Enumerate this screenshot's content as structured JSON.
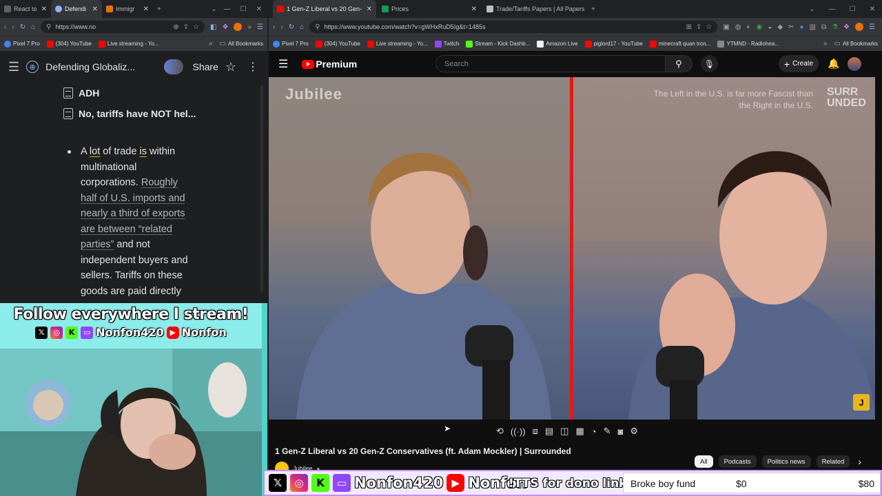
{
  "left_browser": {
    "tabs": [
      {
        "label": "React to",
        "favicon": "#5f6368"
      },
      {
        "label": "Defendi",
        "favicon": "#8ab4f8"
      },
      {
        "label": "Immigr",
        "favicon": "#e37400"
      }
    ],
    "url": "https://www.no",
    "bookmarks": [
      {
        "label": "Pixel 7 Pro",
        "color": "#4285f4"
      },
      {
        "label": "(304) YouTube",
        "color": "#ff0000"
      },
      {
        "label": "Live streaming - Yo...",
        "color": "#ff0000"
      }
    ],
    "all_bookmarks": "All Bookmarks"
  },
  "notebook": {
    "title": "Defending Globaliz...",
    "share": "Share",
    "sources": [
      "ADH",
      "No, tariffs have NOT hel..."
    ],
    "bullet": {
      "part1": "A ",
      "hl1": "lot",
      "part2": " of trade ",
      "hl2": "is",
      "part3": " within multinational corporations. ",
      "cite": "Roughly half of U.S. imports and nearly a third of exports are between “related parties”",
      "part4": " and not independent buyers and sellers. Tariffs on these goods are paid directly"
    }
  },
  "overlay": {
    "title": "Follow everywhere I stream!",
    "handle1": "Nonfon420",
    "handle2": "Nonfon"
  },
  "right_browser": {
    "tabs": [
      {
        "label": "1 Gen-Z Liberal vs 20 Gen-",
        "favicon": "#ff0000"
      },
      {
        "label": "Prices",
        "favicon": "#0f9d58"
      },
      {
        "label": "Trade/Tariffs Papers | All Papers",
        "favicon": "#bdbdbd"
      }
    ],
    "url": "https://www.youtube.com/watch?v=gWHxRuD5Ig&t=1485s",
    "bookmarks": [
      {
        "label": "Pixel 7 Pro",
        "color": "#4285f4"
      },
      {
        "label": "(304) YouTube",
        "color": "#ff0000"
      },
      {
        "label": "Live streaming - Yo...",
        "color": "#ff0000"
      },
      {
        "label": "Twitch",
        "color": "#9146ff"
      },
      {
        "label": "Stream - Kick Dashb...",
        "color": "#53fc18"
      },
      {
        "label": "Amazon Live",
        "color": "#f3f3f3"
      },
      {
        "label": "piglord17 - YouTube",
        "color": "#ff0000"
      },
      {
        "label": "minecraft quan tron...",
        "color": "#ff0000"
      },
      {
        "label": "YTMND - Radiohea...",
        "color": "#888888"
      }
    ],
    "all_bookmarks": "All Bookmarks"
  },
  "youtube": {
    "brand": "Premium",
    "search_placeholder": "Search",
    "create": "Create",
    "video_title": "1 Gen-Z Liberal vs 20 Gen-Z Conservatives (ft. Adam Mockler) | Surrounded",
    "channel": "Jubilee",
    "watermark_left": "Jubilee",
    "watermark_right": "SURR\nUNDED",
    "caption": "The Left in the U.S. is far more Fascist than the Right in the U.S.",
    "chips": [
      "All",
      "Podcasts",
      "Politics news",
      "Related"
    ]
  },
  "streambar": {
    "handle1": "Nonfon420",
    "handle2": "Nonfon",
    "tts": "!TTS for dono link",
    "goal_name": "Broke boy fund",
    "goal_current": "$0",
    "goal_target": "$80",
    "goal_progress": 0
  }
}
